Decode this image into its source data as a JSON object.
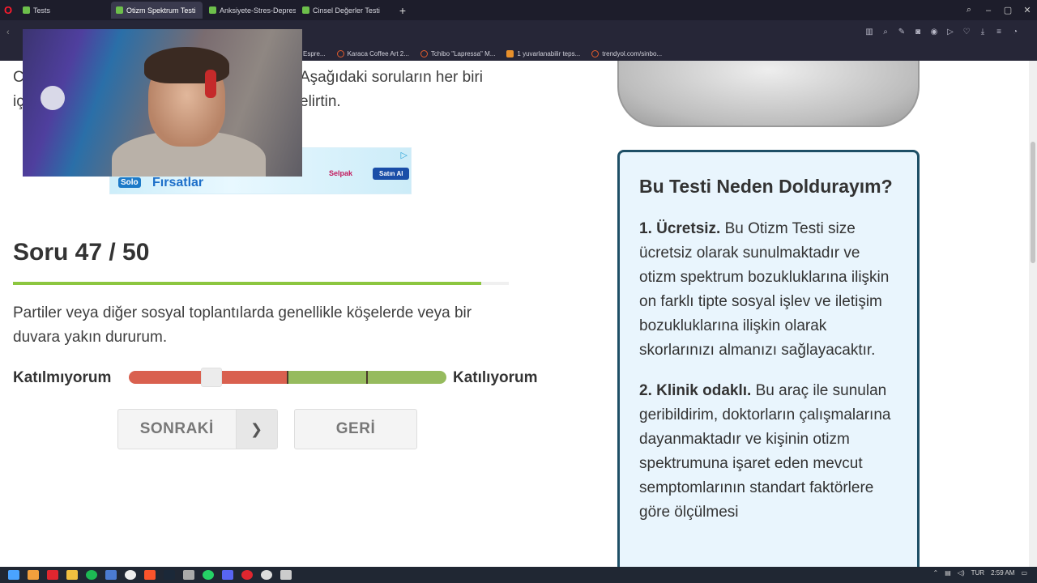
{
  "browser": {
    "tabs": [
      {
        "label": "Tests",
        "active": false
      },
      {
        "label": "Otizm Spektrum Testi",
        "active": true
      },
      {
        "label": "Anksiyete-Stres-Depresyon",
        "active": false
      },
      {
        "label": "Cinsel Değerler Testi",
        "active": false
      }
    ],
    "new_tab": "+"
  },
  "bookmarks": [
    {
      "label": "Espre..."
    },
    {
      "label": "Karaca Coffee Art 2..."
    },
    {
      "label": "Tchibo \"Lapressa\" M..."
    },
    {
      "label": "1 yuvarlanabilir teps..."
    },
    {
      "label": "trendyol.com/sinbo..."
    }
  ],
  "intro": {
    "line1_left": "C",
    "line1_right": "Aşağıdaki soruların her biri",
    "line2_left": "iç",
    "line2_right": "elirtin."
  },
  "ad": {
    "brand": "Solo",
    "text": "Fırsatlar",
    "product": "Selpak",
    "cta": "Satın Al",
    "adchoice": "▷"
  },
  "question": {
    "title": "Soru 47 / 50",
    "progress": 0.945,
    "text": "Partiler veya diğer sosyal toplantılarda genellikle köşelerde veya bir duvara yakın dururum."
  },
  "scale": {
    "left_label": "Katılmıyorum",
    "right_label": "Katılıyorum",
    "colors": {
      "disagree": "#d9604f",
      "agree": "#96bb5e"
    }
  },
  "buttons": {
    "next": "SONRAKİ",
    "next_arrow": "❯",
    "back": "GERİ"
  },
  "sidebar": {
    "heading": "Bu Testi Neden Doldurayım?",
    "items": [
      {
        "title": "1. Ücretsiz.",
        "body": "Bu Otizm Testi size ücretsiz olarak sunulmaktadır ve otizm spektrum bozukluklarına ilişkin on farklı tipte sosyal işlev ve iletişim bozukluklarına ilişkin olarak skorlarınızı almanızı sağlayacaktır."
      },
      {
        "title": "2. Klinik odaklı.",
        "body": "Bu araç ile sunulan geribildirim, doktorların çalışmalarına dayanmaktadır ve kişinin otizm spektrumuna işaret eden mevcut semptomlarının standart faktörlere göre ölçülmesi"
      }
    ]
  },
  "taskbar": {
    "lang": "TUR",
    "time": "2:59 AM"
  }
}
